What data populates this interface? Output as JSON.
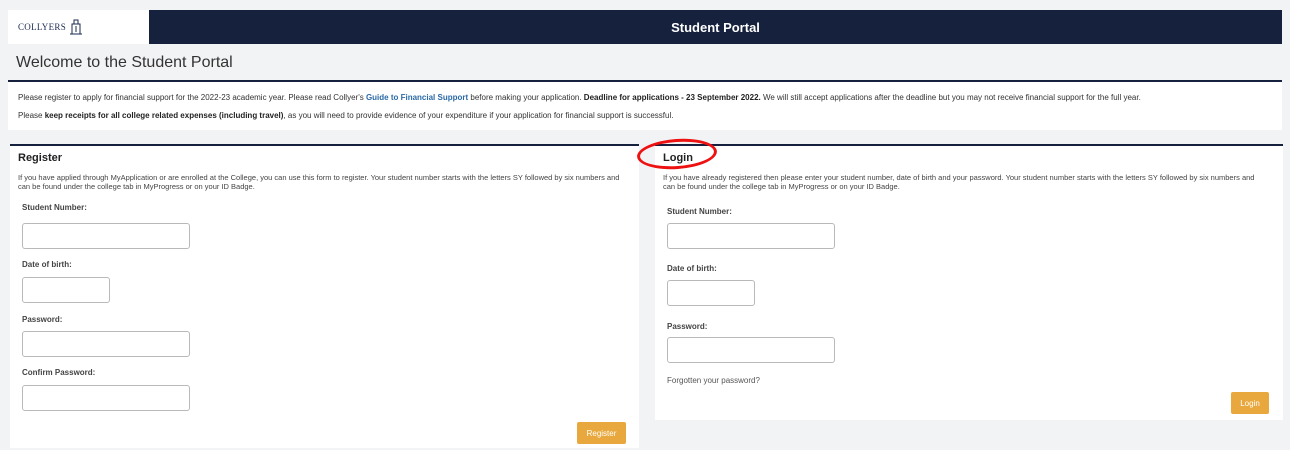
{
  "header": {
    "logo_text": "COLLYERS",
    "portal_title": "Student Portal"
  },
  "welcome": {
    "title": "Welcome to the Student Portal"
  },
  "notice": {
    "line1_pre": "Please register to apply for financial support for the 2022-23 academic year. Please read Collyer's ",
    "line1_link": "Guide to Financial Support",
    "line1_mid": " before making your application. ",
    "line1_bold": "Deadline for applications - 23 September 2022.",
    "line1_post": " We will still accept applications after the deadline but you may not receive financial support for the full year.",
    "line2_pre": "Please ",
    "line2_bold": "keep receipts for all college related expenses (including travel)",
    "line2_post": ", as you will need to provide evidence of your expenditure if your application for financial support is successful."
  },
  "register": {
    "title": "Register",
    "description": "If you have applied through MyApplication or are enrolled at the College, you can use this form to register. Your student number starts with the letters SY followed by six numbers and can be found under the college tab in MyProgress or on your ID Badge.",
    "student_number_label": "Student Number:",
    "student_number_value": "",
    "dob_label": "Date of birth:",
    "dob_value": "",
    "password_label": "Password:",
    "password_value": "",
    "confirm_password_label": "Confirm Password:",
    "confirm_password_value": "",
    "button_label": "Register"
  },
  "login": {
    "title": "Login",
    "description": "If you have already registered then please enter your student number, date of birth and your password. Your student number starts with the letters SY followed by six numbers and can be found under the college tab in MyProgress or on your ID Badge.",
    "student_number_label": "Student Number:",
    "student_number_value": "",
    "dob_label": "Date of birth:",
    "dob_value": "",
    "password_label": "Password:",
    "password_value": "",
    "forgot_label": "Forgotten your password?",
    "button_label": "Login"
  },
  "colors": {
    "navy": "#16213e",
    "accent": "#e8a83d",
    "link": "#2a6aa8",
    "annotation": "#ee1111"
  },
  "icons": {
    "logo_crest": "college-crest-icon"
  }
}
